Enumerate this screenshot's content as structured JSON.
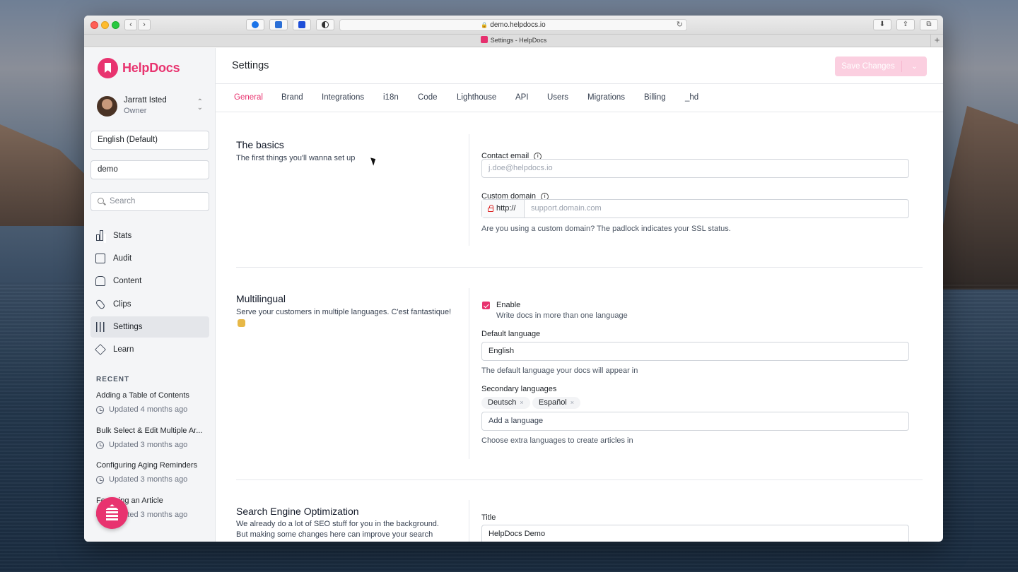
{
  "browser": {
    "url": "demo.helpdocs.io",
    "tab_title": "Settings - HelpDocs"
  },
  "sidebar": {
    "brand": "HelpDocs",
    "user": {
      "name": "Jarratt Isted",
      "role": "Owner"
    },
    "language_select": "English (Default)",
    "project_select": "demo",
    "search_placeholder": "Search",
    "nav": [
      {
        "label": "Stats",
        "icon": "bar-chart-icon"
      },
      {
        "label": "Audit",
        "icon": "clipboard-icon"
      },
      {
        "label": "Content",
        "icon": "archive-icon"
      },
      {
        "label": "Clips",
        "icon": "paperclip-icon"
      },
      {
        "label": "Settings",
        "icon": "sliders-icon",
        "active": true
      },
      {
        "label": "Learn",
        "icon": "graduation-cap-icon"
      }
    ],
    "recent_heading": "RECENT",
    "recent": [
      {
        "title": "Adding a Table of Contents",
        "meta": "Updated 4 months ago"
      },
      {
        "title": "Bulk Select & Edit Multiple Ar...",
        "meta": "Updated 3 months ago"
      },
      {
        "title": "Configuring Aging Reminders",
        "meta": "Updated 3 months ago"
      },
      {
        "title": "Featuring an Article",
        "meta": "Updated 3 months ago"
      }
    ]
  },
  "header": {
    "title": "Settings",
    "save_label": "Save Changes"
  },
  "tabs": [
    "General",
    "Brand",
    "Integrations",
    "i18n",
    "Code",
    "Lighthouse",
    "API",
    "Users",
    "Migrations",
    "Billing",
    "_hd"
  ],
  "basics": {
    "title": "The basics",
    "desc": "The first things you'll wanna set up",
    "contact_email_label": "Contact email",
    "contact_email_placeholder": "j.doe@helpdocs.io",
    "custom_domain_label": "Custom domain",
    "domain_prefix": "http://",
    "domain_placeholder": "support.domain.com",
    "domain_help": "Are you using a custom domain? The padlock indicates your SSL status."
  },
  "multilingual": {
    "title": "Multilingual",
    "desc": "Serve your customers in multiple languages. C'est fantastique!",
    "enable_label": "Enable",
    "enable_sub": "Write docs in more than one language",
    "default_lang_label": "Default language",
    "default_lang_value": "English",
    "default_lang_help": "The default language your docs will appear in",
    "secondary_label": "Secondary languages",
    "secondary_chips": [
      "Deutsch",
      "Español"
    ],
    "add_placeholder": "Add a language",
    "secondary_help": "Choose extra languages to create articles in"
  },
  "seo": {
    "title": "Search Engine Optimization",
    "desc": "We already do a lot of SEO stuff for you in the background. But making some changes here can improve your search engine results.",
    "title_label": "Title",
    "title_value": "HelpDocs Demo"
  },
  "colors": {
    "accent": "#e8336f"
  }
}
